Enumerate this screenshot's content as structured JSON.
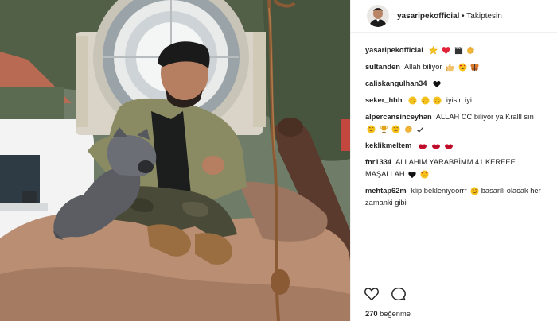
{
  "post": {
    "header": {
      "username": "yasaripekofficial",
      "separator": "•",
      "follow_status": "Takiptesin"
    },
    "comments": [
      {
        "user": "yasaripekofficial",
        "text": "",
        "emoji": [
          "star-icon",
          "heart-icon",
          "clapperboard-icon",
          "clap-icon"
        ]
      },
      {
        "user": "sultanden",
        "text": "Allah biliyor",
        "emoji": [
          "thumbs-up-icon",
          "heart-eyes-icon",
          "butterfly-icon"
        ]
      },
      {
        "user": "caliskangulhan34",
        "text": "",
        "emoji": [
          "black-heart-icon"
        ]
      },
      {
        "user": "seker_hhh",
        "text": "iyisin iyi",
        "emoji_before": [
          "smile-icon",
          "smile-icon",
          "smile-icon"
        ]
      },
      {
        "user": "alpercansinceyhan",
        "text": "ALLAH CC biliyor ya Kralll sın",
        "emoji": [
          "smile-icon",
          "trophy-icon",
          "smile-icon",
          "clap-icon",
          "check-icon"
        ]
      },
      {
        "user": "keklikmeltem",
        "text": "",
        "emoji": [
          "lips-icon",
          "lips-icon",
          "lips-icon"
        ]
      },
      {
        "user": "fnr1334",
        "text": "ALLAHIM YARABBİMM 41 KEREEE MAŞALLAH",
        "emoji": [
          "black-heart-icon",
          "heart-eyes-icon"
        ]
      },
      {
        "user": "mehtap62m",
        "text": "klip bekleniyoorrr",
        "emoji_mid": [
          "smile-icon"
        ],
        "text_after": "basarili olacak her zamanki gibi"
      }
    ],
    "actions": {
      "like_icon": "heart-outline-icon",
      "comment_icon": "comment-icon"
    },
    "likes": {
      "count": "270",
      "label": "beğenme"
    }
  }
}
